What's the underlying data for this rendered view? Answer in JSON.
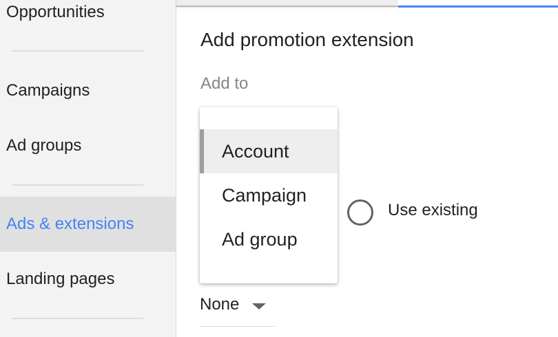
{
  "sidebar": {
    "items": [
      {
        "label": "Opportunities"
      },
      {
        "label": "Campaigns"
      },
      {
        "label": "Ad groups"
      },
      {
        "label": "Ads & extensions",
        "active": true
      },
      {
        "label": "Landing pages"
      }
    ]
  },
  "panel": {
    "title": "Add promotion extension",
    "add_to_label": "Add to",
    "dropdown_options": [
      "Account",
      "Campaign",
      "Ad group"
    ],
    "selected_option": "Account",
    "radio_use_existing_label": "Use existing",
    "select_value": "None"
  },
  "colors": {
    "accent": "#4285f4",
    "sidebar_bg": "#f3f3f3",
    "active_bg": "#e0e0e0"
  }
}
